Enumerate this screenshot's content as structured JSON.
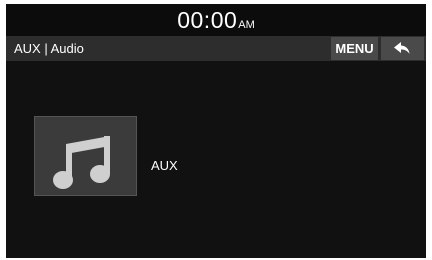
{
  "status": {
    "time": "00:00",
    "ampm": "AM"
  },
  "header": {
    "title": "AUX | Audio",
    "menu_label": "MENU",
    "back_icon": "back-arrow-icon"
  },
  "main": {
    "art_icon": "music-note-icon",
    "source_label": "AUX"
  },
  "colors": {
    "screen_bg": "#111111",
    "title_bar_bg": "#2d2d2d",
    "button_bg": "#4a4a4a",
    "art_bg": "#3b3b3b",
    "icon_color": "#cfcfcf",
    "text": "#ffffff"
  }
}
